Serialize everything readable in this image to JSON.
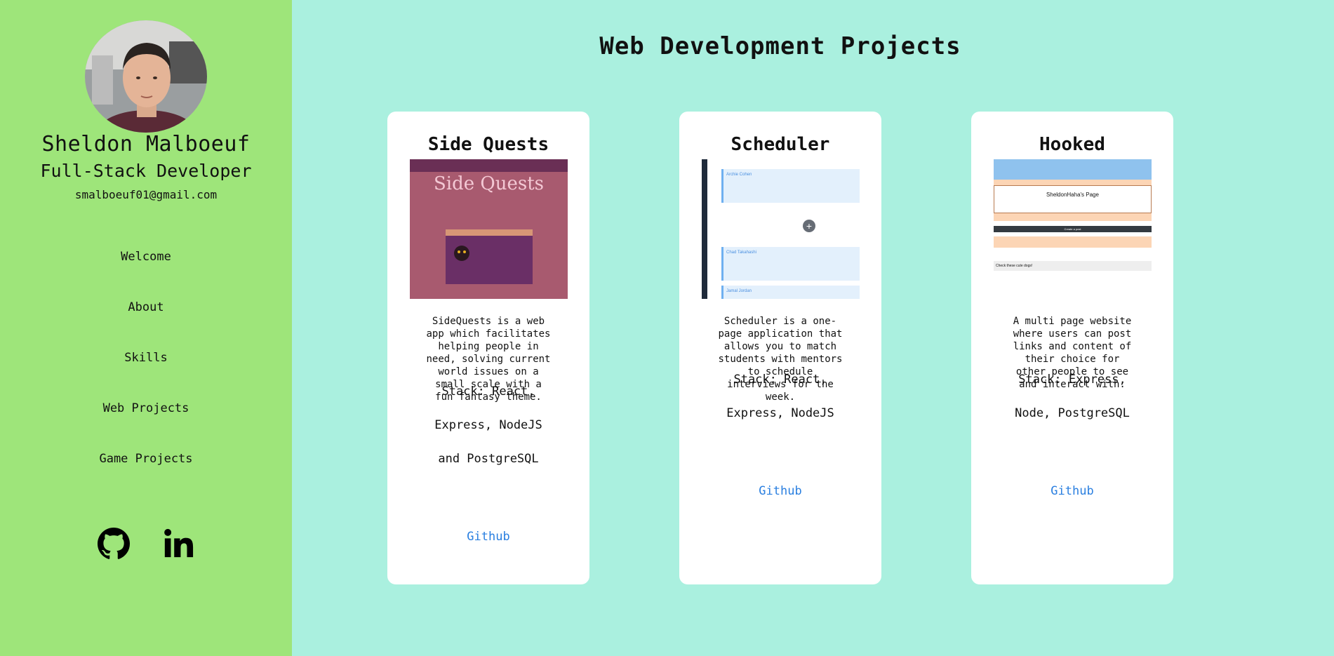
{
  "profile": {
    "name": "Sheldon Malboeuf",
    "role": "Full-Stack Developer",
    "email": "smalboeuf01@gmail.com"
  },
  "nav": [
    "Welcome",
    "About",
    "Skills",
    "Web Projects",
    "Game Projects"
  ],
  "social": [
    "github-icon",
    "linkedin-icon"
  ],
  "colors": {
    "sidebar": "#9ee57a",
    "main": "#aaf0df",
    "link": "#2a7fe0"
  },
  "page_title": "Web Development Projects",
  "projects": [
    {
      "title": "Side Quests",
      "description": "SideQuests is a web app which facilitates helping people in need, solving current world issues on a small scale with a fun fantasy theme.",
      "stack_lines": [
        "Stack: React,",
        "Express, NodeJS",
        "and PostgreSQL"
      ],
      "link": "Github",
      "preview": {
        "logo": "Side Quests"
      }
    },
    {
      "title": "Scheduler",
      "description": "Scheduler is a one-page application that allows you to match students with mentors to schedule interviews for the week.",
      "stack_lines": [
        "Stack: React,",
        "Express, NodeJS"
      ],
      "link": "Github",
      "preview": {
        "slot1": "Archie Cohen",
        "slot2": "Chad Takahashi",
        "slot3": "Jamal Jordan"
      }
    },
    {
      "title": "Hooked",
      "description": "A multi page website where users can post links and content of their choice for other people to see and interact with.",
      "stack_lines": [
        "Stack: Express,",
        "Node, PostgreSQL"
      ],
      "link": "Github",
      "preview": {
        "heading": "SheldonHaha's Page",
        "post_button": "Create a post",
        "item": "Check these cute dogs!"
      }
    }
  ]
}
